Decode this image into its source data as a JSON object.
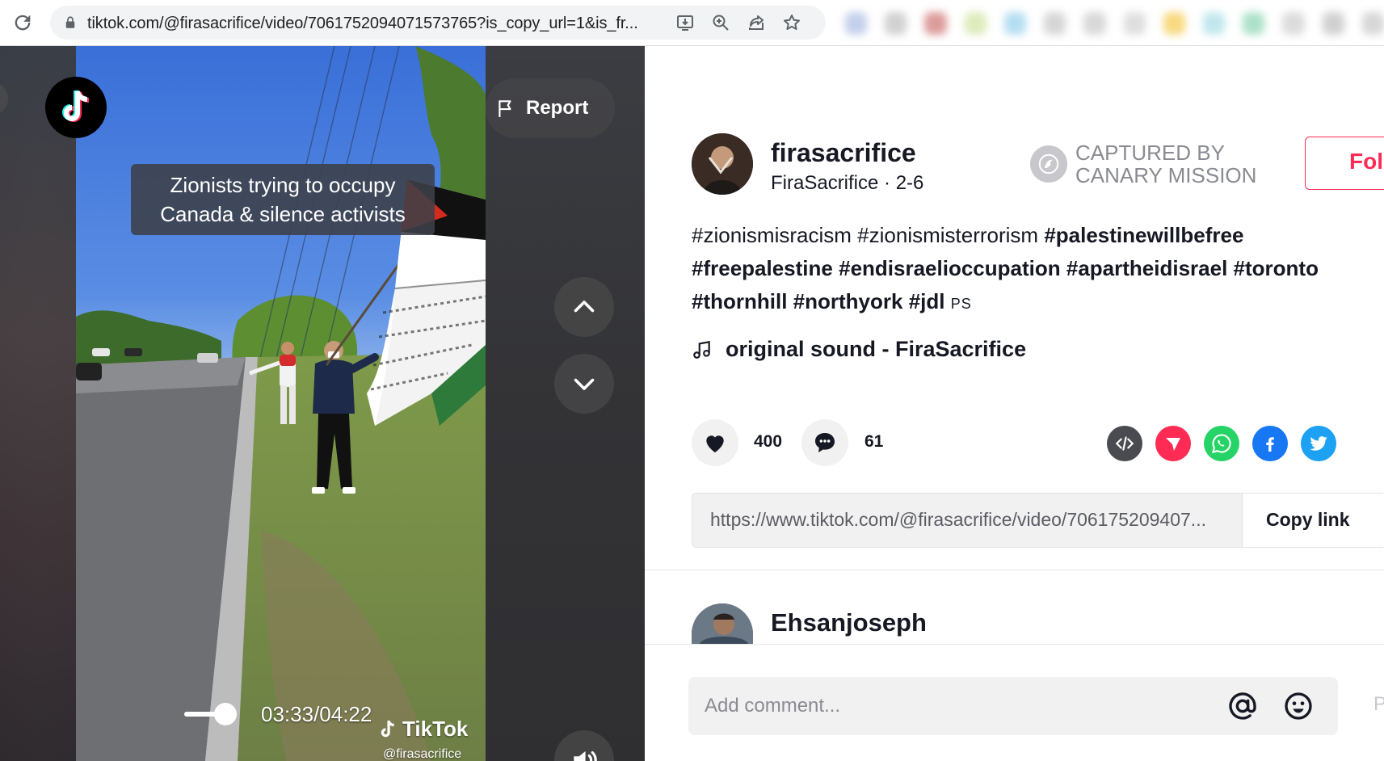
{
  "browser": {
    "url": "tiktok.com/@firasacrifice/video/7061752094071573765?is_copy_url=1&is_fr..."
  },
  "video": {
    "caption_line1": "Zionists trying to occupy",
    "caption_line2": "Canada & silence activists",
    "report_label": "Report",
    "timecode": "03:33/04:22",
    "progress_fraction": 0.8,
    "watermark_brand": "TikTok",
    "watermark_handle": "@firasacrifice"
  },
  "author": {
    "username": "firasacrifice",
    "display_name": "FiraSacrifice",
    "date": "2-6",
    "meta_separator": " · ",
    "canary_line1": "CAPTURED BY",
    "canary_line2": "CANARY MISSION",
    "follow_label": "Follow"
  },
  "description": {
    "tags": [
      {
        "text": "#zionismisracism",
        "weight": "light"
      },
      {
        "text": "#zionismisterrorism",
        "weight": "light"
      },
      {
        "text": "#palestinewillbefree",
        "weight": "bold"
      },
      {
        "text": "#freepalestine",
        "weight": "bold"
      },
      {
        "text": "#endisraelioccupation",
        "weight": "bold"
      },
      {
        "text": "#apartheidisrael",
        "weight": "bold"
      },
      {
        "text": "#toronto",
        "weight": "bold"
      },
      {
        "text": "#thornhill",
        "weight": "bold"
      },
      {
        "text": "#northyork",
        "weight": "bold"
      },
      {
        "text": "#jdl",
        "weight": "bold"
      }
    ],
    "suffix": "PS"
  },
  "sound": {
    "label": "original sound - FiraSacrifice"
  },
  "stats": {
    "likes": "400",
    "comments": "61"
  },
  "share": {
    "icons": [
      "embed-icon",
      "send-to-friends-icon",
      "whatsapp-icon",
      "facebook-icon",
      "twitter-icon"
    ],
    "colors": {
      "embed": "#4a4b50",
      "send": "#fe2c55",
      "whatsapp": "#25d366",
      "facebook": "#1877f2",
      "twitter": "#1da1f2"
    }
  },
  "link": {
    "url": "https://www.tiktok.com/@firasacrifice/video/706175209407...",
    "copy_label": "Copy link"
  },
  "comments": {
    "first_user": "Ehsanjoseph",
    "input_placeholder": "Add comment...",
    "post_label": "Post"
  },
  "colors": {
    "accent": "#fe2c55",
    "text": "#161823",
    "muted": "#8a8b91"
  }
}
